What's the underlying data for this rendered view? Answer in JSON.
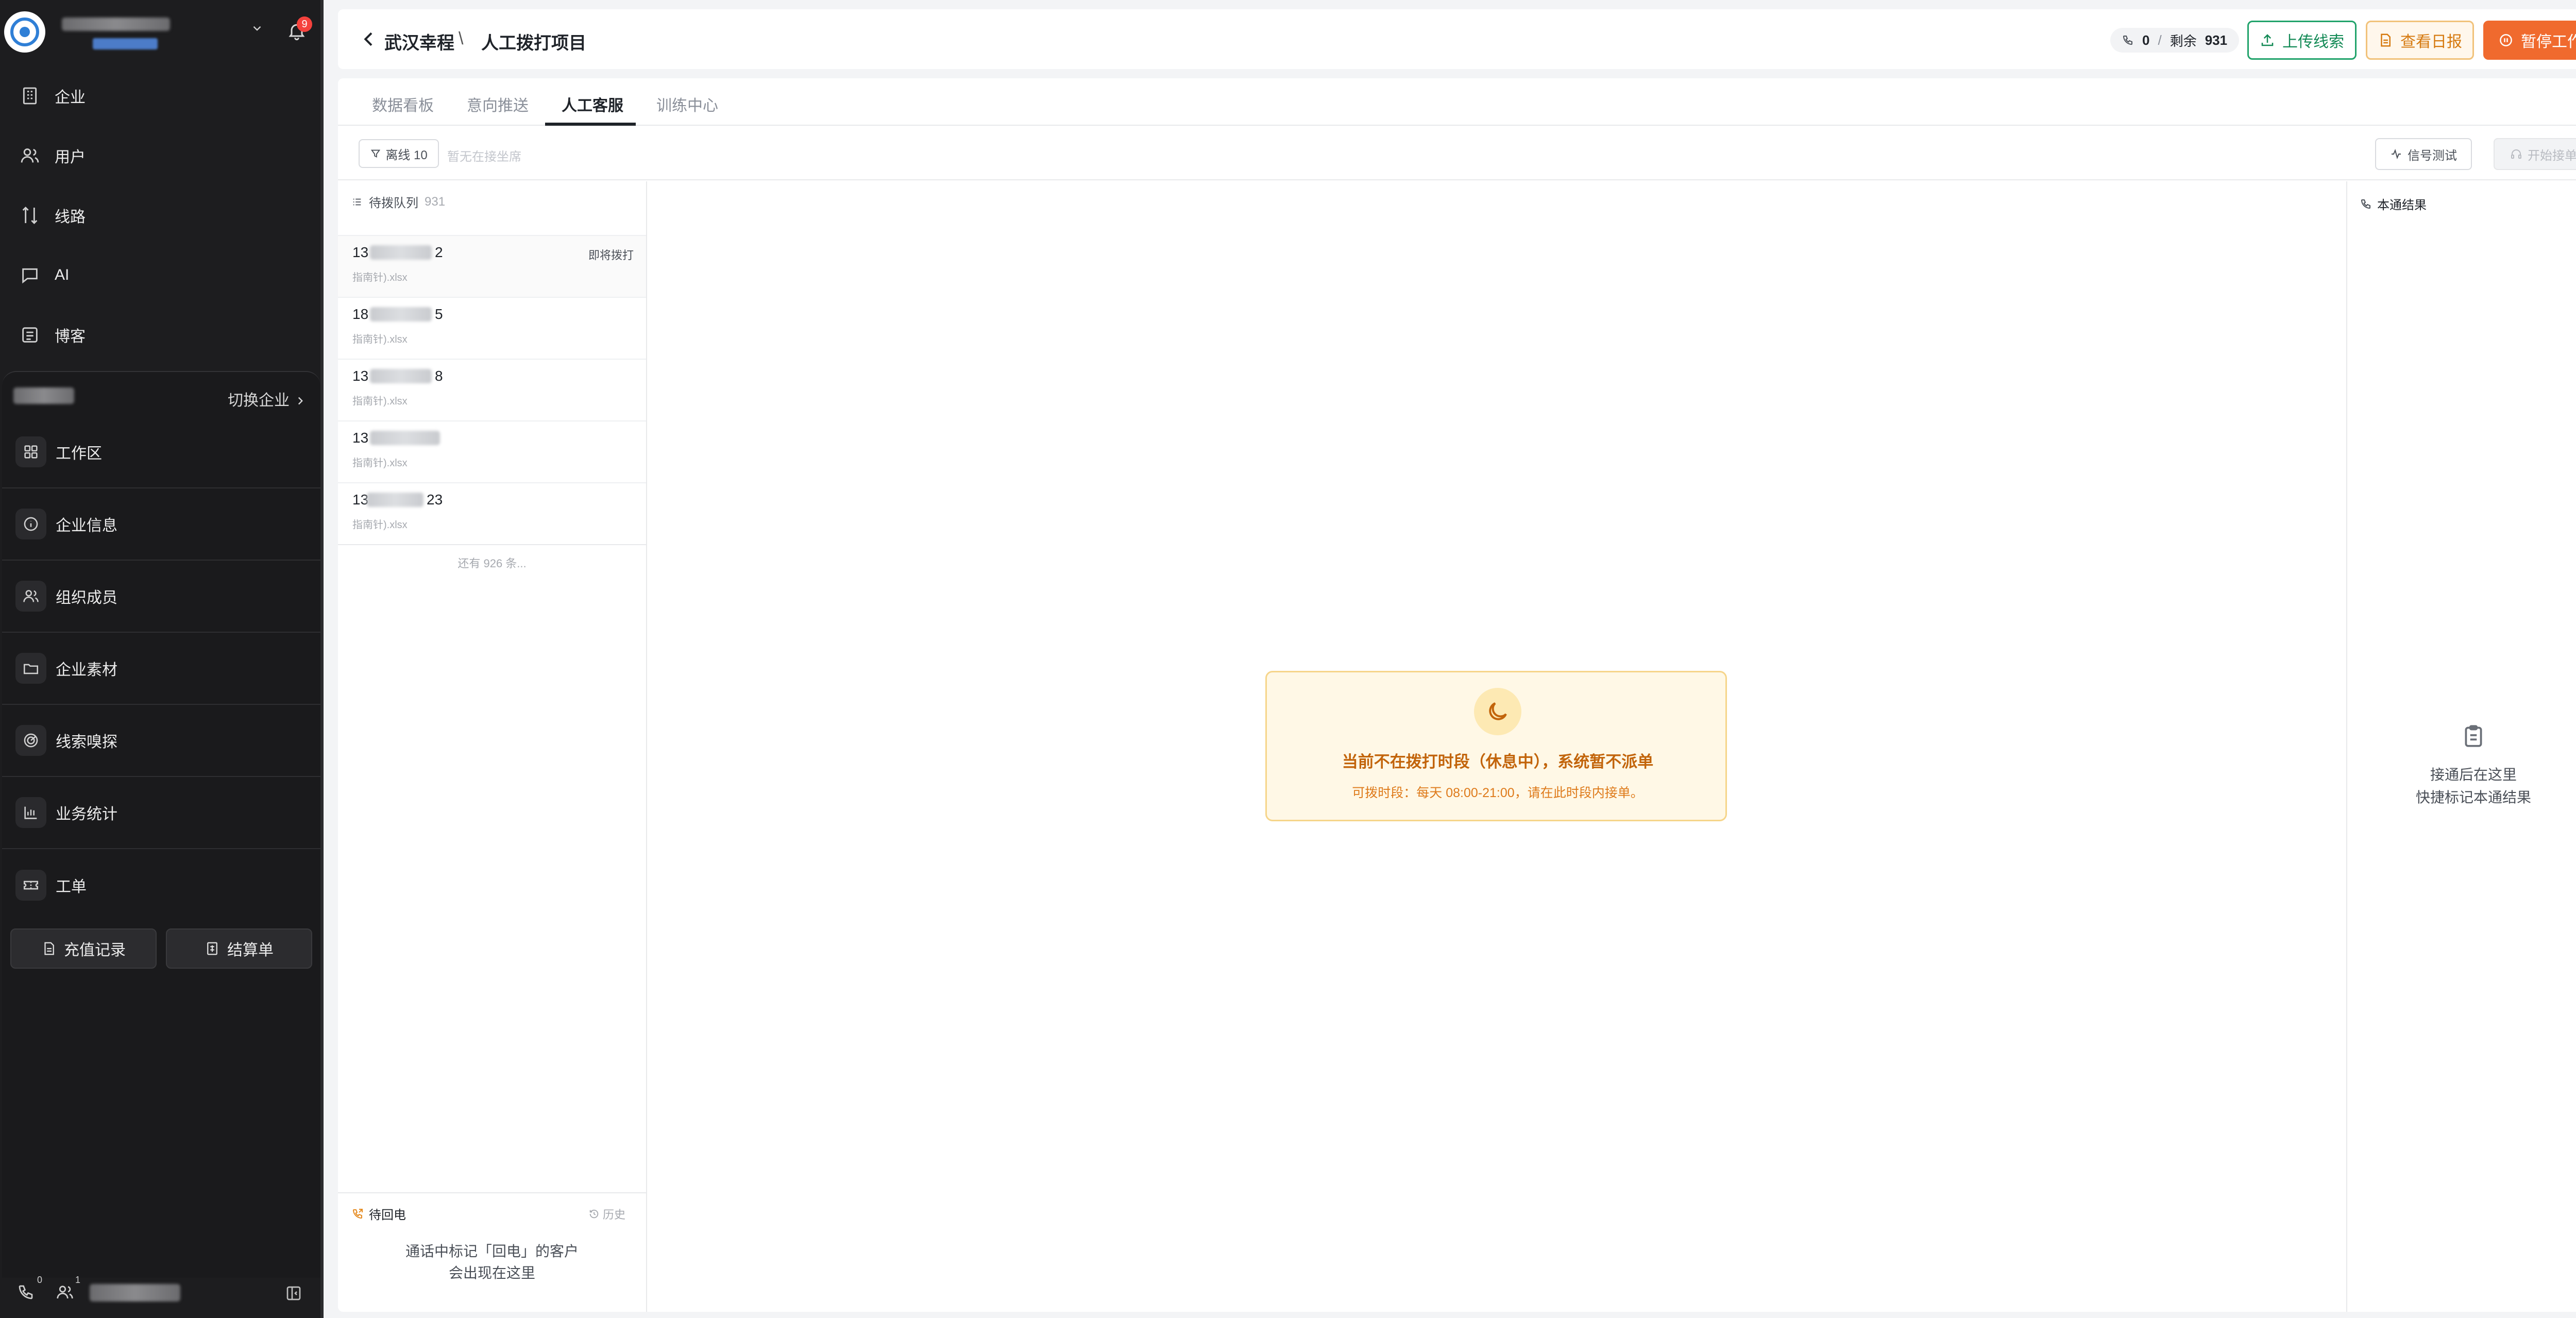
{
  "sidebar": {
    "notification_count": "9",
    "primary_nav": [
      {
        "label": "企业",
        "icon": "building-icon"
      },
      {
        "label": "用户",
        "icon": "users-icon"
      },
      {
        "label": "线路",
        "icon": "route-icon"
      },
      {
        "label": "AI",
        "icon": "chat-icon"
      },
      {
        "label": "博客",
        "icon": "blog-icon"
      }
    ],
    "switch_enterprise_label": "切换企业",
    "sub_nav": [
      {
        "label": "工作区",
        "icon": "grid-icon"
      },
      {
        "label": "企业信息",
        "icon": "info-icon"
      },
      {
        "label": "组织成员",
        "icon": "members-icon"
      },
      {
        "label": "企业素材",
        "icon": "folder-icon"
      },
      {
        "label": "线索嗅探",
        "icon": "radar-icon"
      },
      {
        "label": "业务统计",
        "icon": "bar-chart-icon"
      },
      {
        "label": "工单",
        "icon": "ticket-icon"
      }
    ],
    "buttons": {
      "recharge": "充值记录",
      "statement": "结算单"
    },
    "footer": {
      "phone_count": "0",
      "user_count": "1"
    }
  },
  "topbar": {
    "breadcrumb_root": "武汉幸程",
    "breadcrumb_sep": "\\",
    "breadcrumb_current": "人工拨打项目",
    "stats": {
      "calls": "0",
      "sep": "/",
      "remaining_label": "剩余",
      "remaining": "931"
    },
    "upload_label": "上传线索",
    "report_label": "查看日报",
    "pause_label": "暂停工作"
  },
  "tabs": [
    {
      "label": "数据看板",
      "active": false
    },
    {
      "label": "意向推送",
      "active": false
    },
    {
      "label": "人工客服",
      "active": true
    },
    {
      "label": "训练中心",
      "active": false
    }
  ],
  "filterbar": {
    "offline_label": "离线 10",
    "hint": "暂无在接坐席",
    "signal_test": "信号测试",
    "start_accept": "开始接单"
  },
  "queue": {
    "title": "待拨队列",
    "count": "931",
    "rows": [
      {
        "prefix": "13",
        "suffix": "2",
        "file": "指南针).xlsx",
        "tag": "即将拨打"
      },
      {
        "prefix": "18",
        "suffix": "5",
        "file": "指南针).xlsx",
        "tag": ""
      },
      {
        "prefix": "13",
        "suffix": "8",
        "file": "指南针).xlsx",
        "tag": ""
      },
      {
        "prefix": "13",
        "suffix": "",
        "file": "指南针).xlsx",
        "tag": ""
      },
      {
        "prefix": "13",
        "suffix": "23",
        "file": "指南针).xlsx",
        "tag": ""
      }
    ],
    "more": "还有 926 条..."
  },
  "callback": {
    "title": "待回电",
    "history": "历史",
    "empty_line1": "通话中标记「回电」的客户",
    "empty_line2": "会出现在这里"
  },
  "notice": {
    "title": "当前不在拨打时段（休息中），系统暂不派单",
    "subtitle": "可拨时段：每天 08:00-21:00，请在此时段内接单。"
  },
  "result": {
    "title": "本通结果",
    "empty_line1": "接通后在这里",
    "empty_line2": "快捷标记本通结果"
  },
  "colors": {
    "sidebar_bg": "#1d1d1f",
    "pause_button": "#f06a2e",
    "upload_green": "#21a36b",
    "report_orange": "#d67a10",
    "notice_bg": "#fff8e6",
    "notice_text": "#c2640a"
  }
}
